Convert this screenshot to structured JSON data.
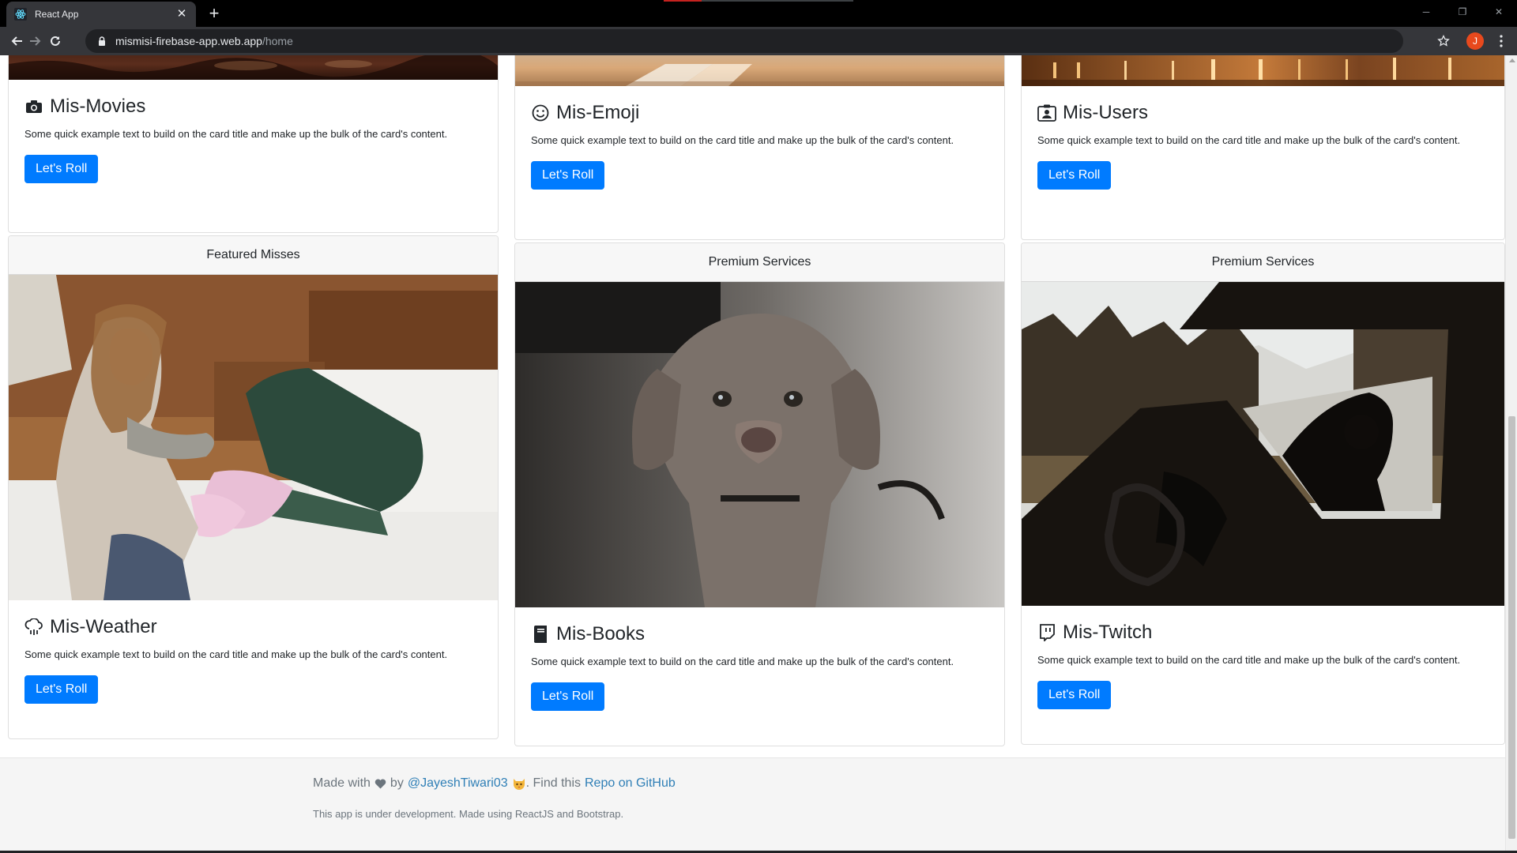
{
  "browser": {
    "tab_title": "React App",
    "tab_close": "✕",
    "new_tab": "+",
    "url_host": "mismisi-firebase-app.web.app",
    "url_path": "/home",
    "profile_initial": "J",
    "window_controls": [
      "─",
      "❐",
      "✕"
    ]
  },
  "cards": [
    {
      "id": "movies",
      "header": "",
      "icon": "camera-icon",
      "title": "Mis-Movies",
      "text": "Some quick example text to build on the card title and make up the bulk of the card's content.",
      "button": "Let's Roll"
    },
    {
      "id": "emoji",
      "header": "",
      "icon": "smiley-icon",
      "title": "Mis-Emoji",
      "text": "Some quick example text to build on the card title and make up the bulk of the card's content.",
      "button": "Let's Roll"
    },
    {
      "id": "users",
      "header": "",
      "icon": "user-card-icon",
      "title": "Mis-Users",
      "text": "Some quick example text to build on the card title and make up the bulk of the card's content.",
      "button": "Let's Roll"
    },
    {
      "id": "weather",
      "header": "Featured Misses",
      "icon": "cloud-rain-icon",
      "title": "Mis-Weather",
      "text": "Some quick example text to build on the card title and make up the bulk of the card's content.",
      "button": "Let's Roll"
    },
    {
      "id": "books",
      "header": "Premium Services",
      "icon": "book-icon",
      "title": "Mis-Books",
      "text": "Some quick example text to build on the card title and make up the bulk of the card's content.",
      "button": "Let's Roll"
    },
    {
      "id": "twitch",
      "header": "Premium Services",
      "icon": "twitch-icon",
      "title": "Mis-Twitch",
      "text": "Some quick example text to build on the card title and make up the bulk of the card's content.",
      "button": "Let's Roll"
    }
  ],
  "footer": {
    "made_with": "Made with",
    "by": "by",
    "author_link": "@JayeshTiwari03",
    "find_this": ". Find this",
    "repo_link": "Repo on GitHub",
    "note": "This app is under development. Made using ReactJS and Bootstrap."
  },
  "colors": {
    "primary_button": "#007bff",
    "link": "#2f7fb6",
    "footer_bg": "#f5f5f5"
  }
}
